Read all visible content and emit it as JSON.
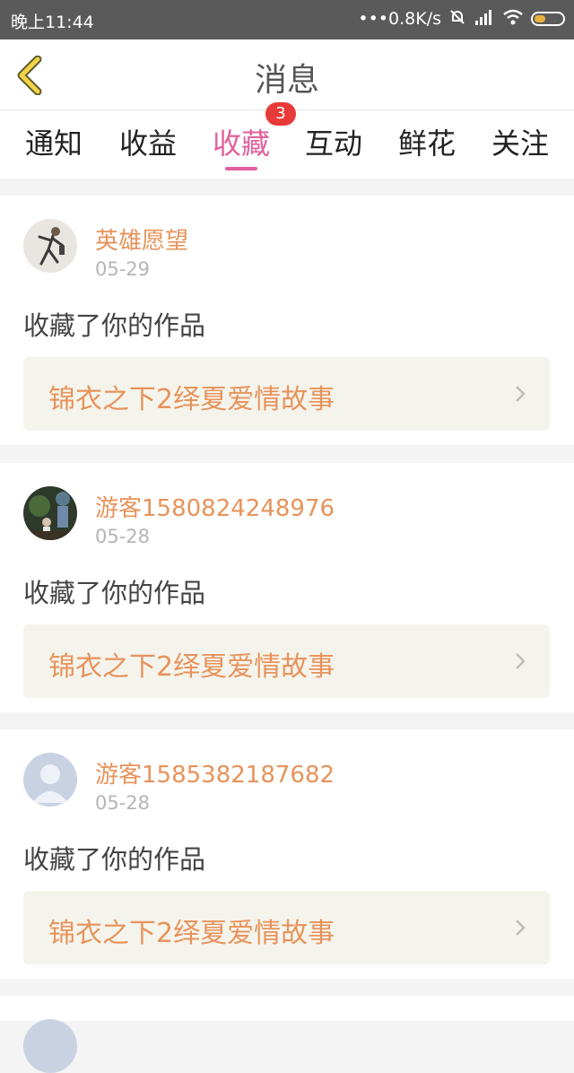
{
  "status_bar": {
    "time": "晚上11:44",
    "network_speed": "•••0.8K/s"
  },
  "header": {
    "title": "消息"
  },
  "tabs": [
    {
      "label": "通知"
    },
    {
      "label": "收益"
    },
    {
      "label": "收藏",
      "badge": "3"
    },
    {
      "label": "互动"
    },
    {
      "label": "鲜花"
    },
    {
      "label": "关注"
    }
  ],
  "colors": {
    "accent": "#e0609b",
    "username": "#e7935b",
    "badge": "#e83a3a"
  },
  "messages": [
    {
      "username": "英雄愿望",
      "date": "05-29",
      "action": "收藏了你的作品",
      "work_title": "锦衣之下2绎夏爱情故事"
    },
    {
      "username": "游客1580824248976",
      "date": "05-28",
      "action": "收藏了你的作品",
      "work_title": "锦衣之下2绎夏爱情故事"
    },
    {
      "username": "游客1585382187682",
      "date": "05-28",
      "action": "收藏了你的作品",
      "work_title": "锦衣之下2绎夏爱情故事"
    }
  ]
}
